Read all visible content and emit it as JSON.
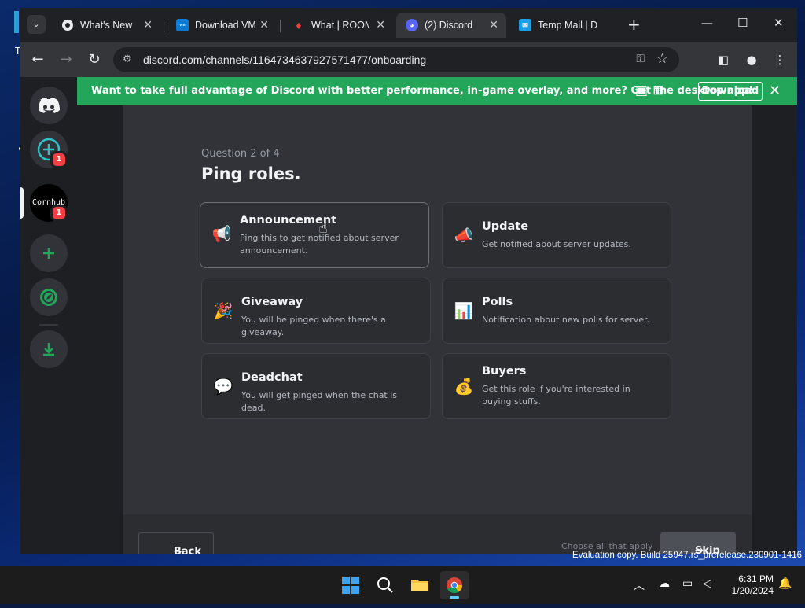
{
  "desktop": {
    "corner_letter": "T"
  },
  "browser": {
    "tabs": [
      {
        "title": "What's New",
        "favicon": "chrome-icon",
        "active": false
      },
      {
        "title": "Download VM",
        "favicon": "vmware-icon",
        "active": false
      },
      {
        "title": "What | ROOM",
        "favicon": "flame-icon",
        "active": false
      },
      {
        "title": "(2) Discord",
        "favicon": "discord-icon",
        "active": true
      },
      {
        "title": "Temp Mail | D",
        "favicon": "mail-icon",
        "active": false
      }
    ],
    "url": "discord.com/channels/1164734637927571477/onboarding"
  },
  "rail": {
    "explore_badge": "1",
    "server_name": "Cornhub",
    "server_badge": "1"
  },
  "banner": {
    "text": "Want to take full advantage of Discord with better performance, in-game overlay, and more? Get the desktop app!",
    "download_label": "Download",
    "platforms": [
      "apple-icon",
      "android-icon",
      "windows-icon"
    ]
  },
  "onboarding": {
    "question_count": "Question 2 of 4",
    "title": "Ping roles.",
    "options": [
      {
        "emoji": "📢",
        "title": "Announcement",
        "desc": "Ping this to get notified about server announcement."
      },
      {
        "emoji": "📣",
        "title": "Update",
        "desc": "Get notified about server updates."
      },
      {
        "emoji": "🎉",
        "title": "Giveaway",
        "desc": "You will be pinged when there's a giveaway."
      },
      {
        "emoji": "📊",
        "title": "Polls",
        "desc": "Notification about new polls for server."
      },
      {
        "emoji": "💬",
        "title": "Deadchat",
        "desc": "You will get pinged when the chat is dead."
      },
      {
        "emoji": "💰",
        "title": "Buyers",
        "desc": "Get this role if you're interested in buying stuffs."
      }
    ],
    "back_label": "Back",
    "hint": "Choose all that apply",
    "skip_label": "Skip"
  },
  "system": {
    "watermark": "Evaluation copy. Build 25947.rs_prerelease.230901-1416",
    "time": "6:31 PM",
    "date": "1/20/2024"
  },
  "colors": {
    "banner_green": "#23a55a",
    "discord_blurple": "#5865f2",
    "badge_red": "#f23f43",
    "rail_green": "#23a55a"
  }
}
